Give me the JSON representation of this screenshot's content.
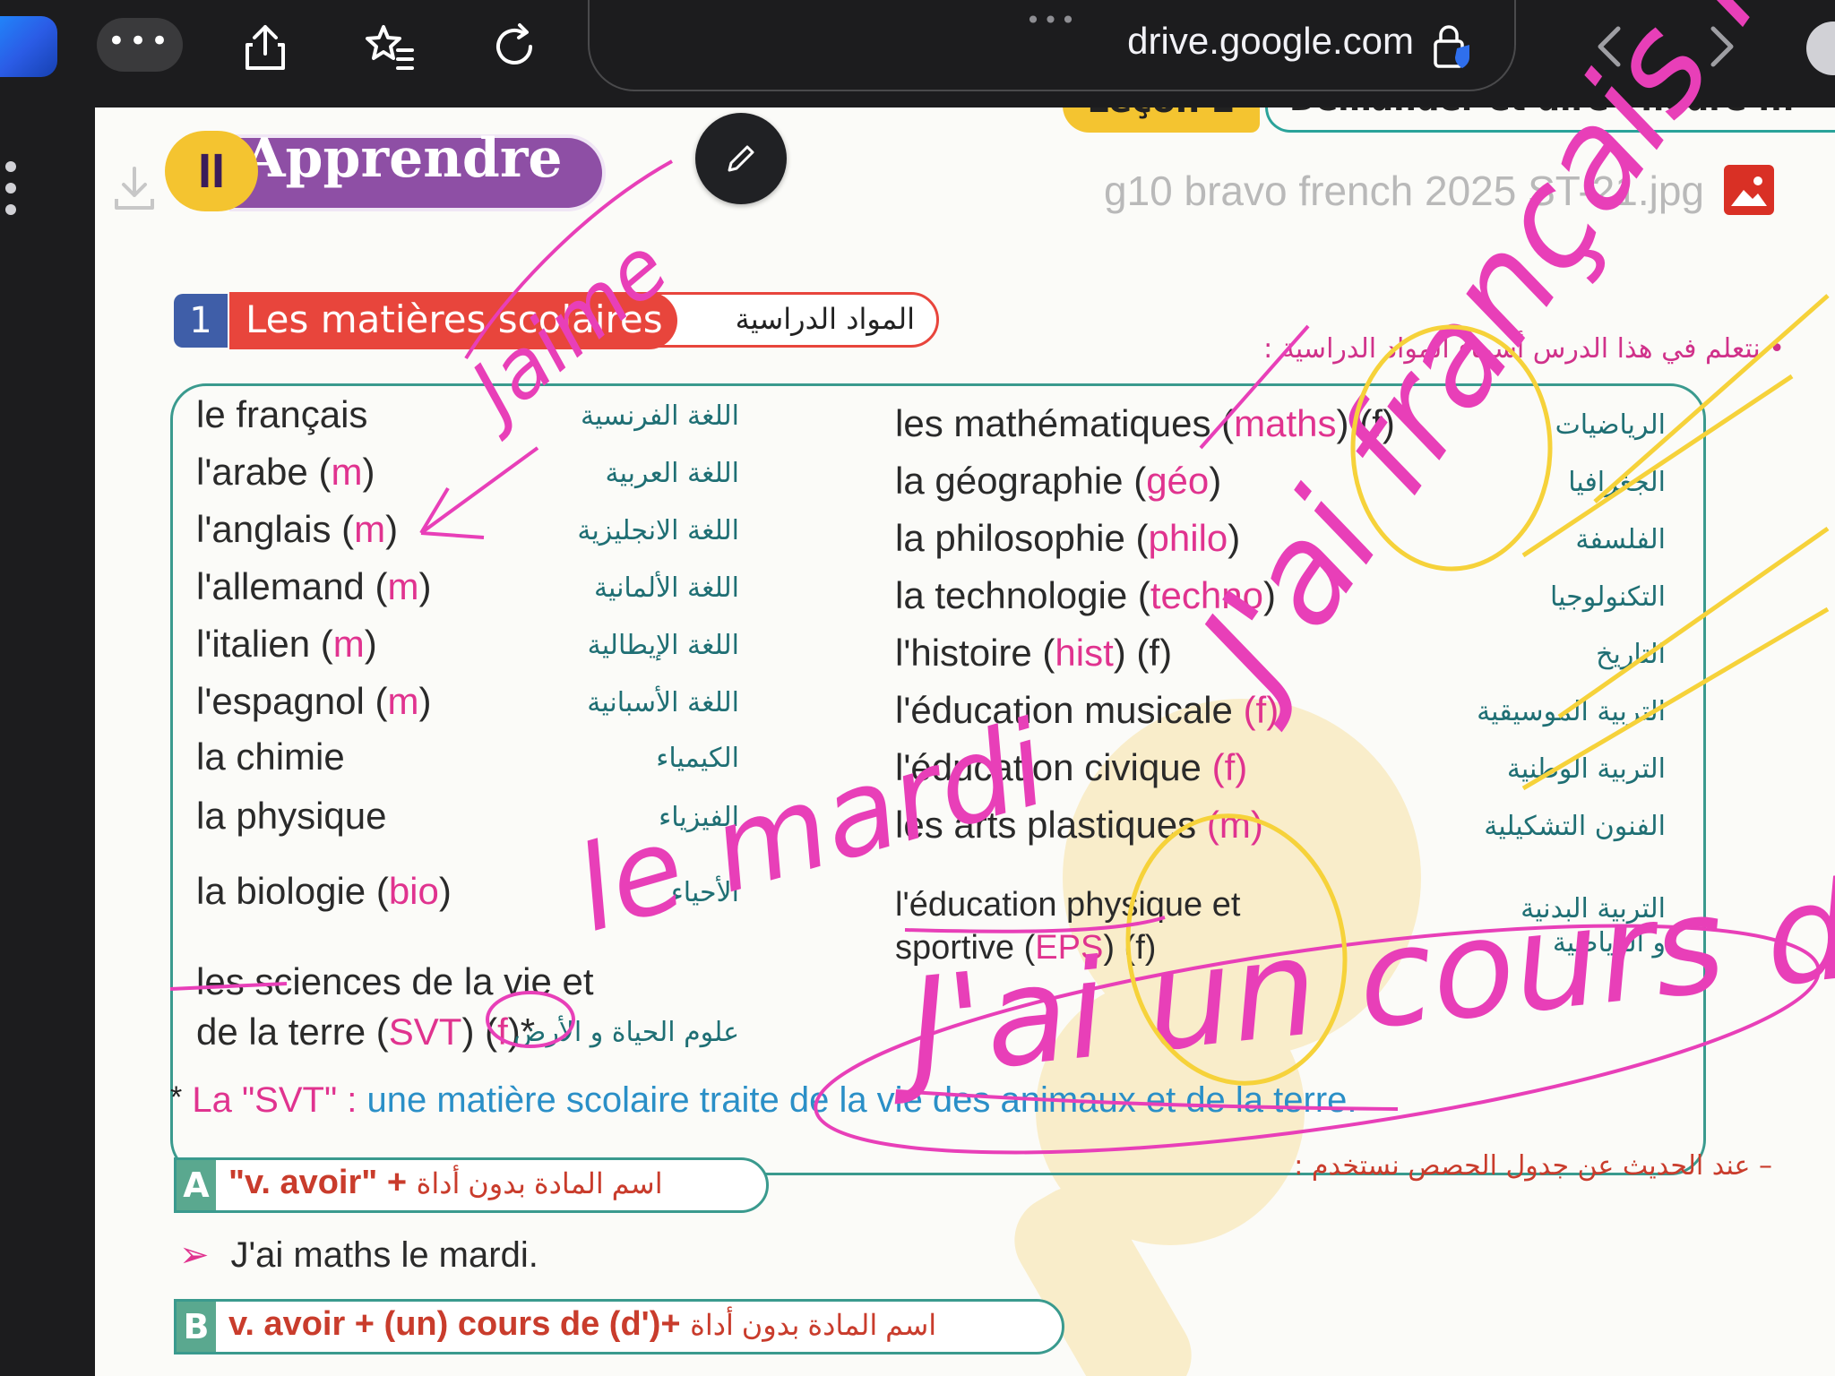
{
  "browser": {
    "url": "drive.google.com",
    "url_dots": "•••",
    "more_label": "•••"
  },
  "viewer": {
    "file_name": "g10 bravo french 2025 ST-21.jpg"
  },
  "page": {
    "lecon_tag": "Leçon 2",
    "lecon_title": "Demander et dire l'heure ...",
    "apprendre_num": "II",
    "apprendre_label": "Apprendre",
    "section_num": "1",
    "section_title": "Les matières scolaires",
    "section_title_ar": "المواد الدراسية",
    "subtitle_ar": "• نتعلم في هذا الدرس أسماء المواد الدراسية :",
    "left_subjects": [
      {
        "fr": "le français",
        "g": "",
        "ar": "اللغة الفرنسية"
      },
      {
        "fr": "l'arabe (",
        "g": "m",
        "end": ")",
        "ar": "اللغة العربية"
      },
      {
        "fr": "l'anglais (",
        "g": "m",
        "end": ")",
        "ar": "اللغة الانجليزية"
      },
      {
        "fr": "l'allemand (",
        "g": "m",
        "end": ")",
        "ar": "اللغة الألمانية"
      },
      {
        "fr": "l'italien (",
        "g": "m",
        "end": ")",
        "ar": "اللغة الإيطالية"
      },
      {
        "fr": "l'espagnol (",
        "g": "m",
        "end": ")",
        "ar": "اللغة الأسبانية"
      },
      {
        "fr": "la chimie",
        "g": "",
        "ar": "الكيمياء"
      },
      {
        "fr": "la physique",
        "g": "",
        "ar": "الفيزياء"
      },
      {
        "fr": "la biologie (",
        "g": "bio",
        "end": ")",
        "ar": "الأحياء"
      }
    ],
    "svt": {
      "line1": "les sciences de la vie et",
      "line2a": "de la terre (",
      "abbr": "SVT",
      "line2b": ") ",
      "g": "f",
      "line2c": ")*",
      "ar": "علوم الحياة و الأرض"
    },
    "right_subjects": [
      {
        "fr": "les mathématiques (",
        "g": "maths",
        "end": ") (f)",
        "ar": "الرياضيات"
      },
      {
        "fr": "la géographie (",
        "g": "géo",
        "end": ")",
        "ar": "الجغرافيا"
      },
      {
        "fr": "la philosophie (",
        "g": "philo",
        "end": ")",
        "ar": "الفلسفة"
      },
      {
        "fr": "la technologie (",
        "g": "techno",
        "end": ")",
        "ar": "التكنولوجيا"
      },
      {
        "fr": "l'histoire (",
        "g": "hist",
        "end": ") (f)",
        "ar": "التاريخ"
      },
      {
        "fr": "l'éducation musicale ",
        "g": "(f)",
        "end": "",
        "ar": "التربية الموسيقية"
      },
      {
        "fr": "l'éducation civique ",
        "g": "(f)",
        "end": "",
        "ar": "التربية الوطنية"
      },
      {
        "fr": "les arts plastiques ",
        "g": "(m)",
        "end": "",
        "ar": "الفنون التشكيلية"
      }
    ],
    "eps": {
      "line1": "l'éducation physique et",
      "line2a": "sportive (",
      "abbr": "EPS",
      "line2b": ") (f)",
      "ar1": "التربية البدنية",
      "ar2": "و الرياضية"
    },
    "note": {
      "star": "*",
      "lead": "La \"SVT\" :",
      "body": " une matière scolaire traite de la vie des animaux et de la terre."
    },
    "note_ar": "– عند الحديث عن جدول الحصص نستخدم :",
    "rule_a": {
      "letter": "A",
      "text": "\"v. avoir\" + ",
      "ar": "اسم المادة بدون أداة"
    },
    "example": {
      "arrow": "➢",
      "text": "J'ai maths le mardi."
    },
    "rule_b": {
      "letter": "B",
      "text": "v. avoir + (un) cours de (d')+ ",
      "ar": "اسم المادة بدون أداة"
    }
  },
  "handwriting": {
    "top_word": "Jaime",
    "margin_sentence": "J'ai français le lundi.",
    "middle": "le mardi",
    "bottom": "J'ai un cours de le mardi."
  },
  "colors": {
    "ink_pink": "#e83fb8",
    "ink_yellow": "#f6d23a",
    "accent_red": "#e8453c",
    "accent_purple": "#8e4fa5",
    "teal": "#3a9a8e"
  }
}
